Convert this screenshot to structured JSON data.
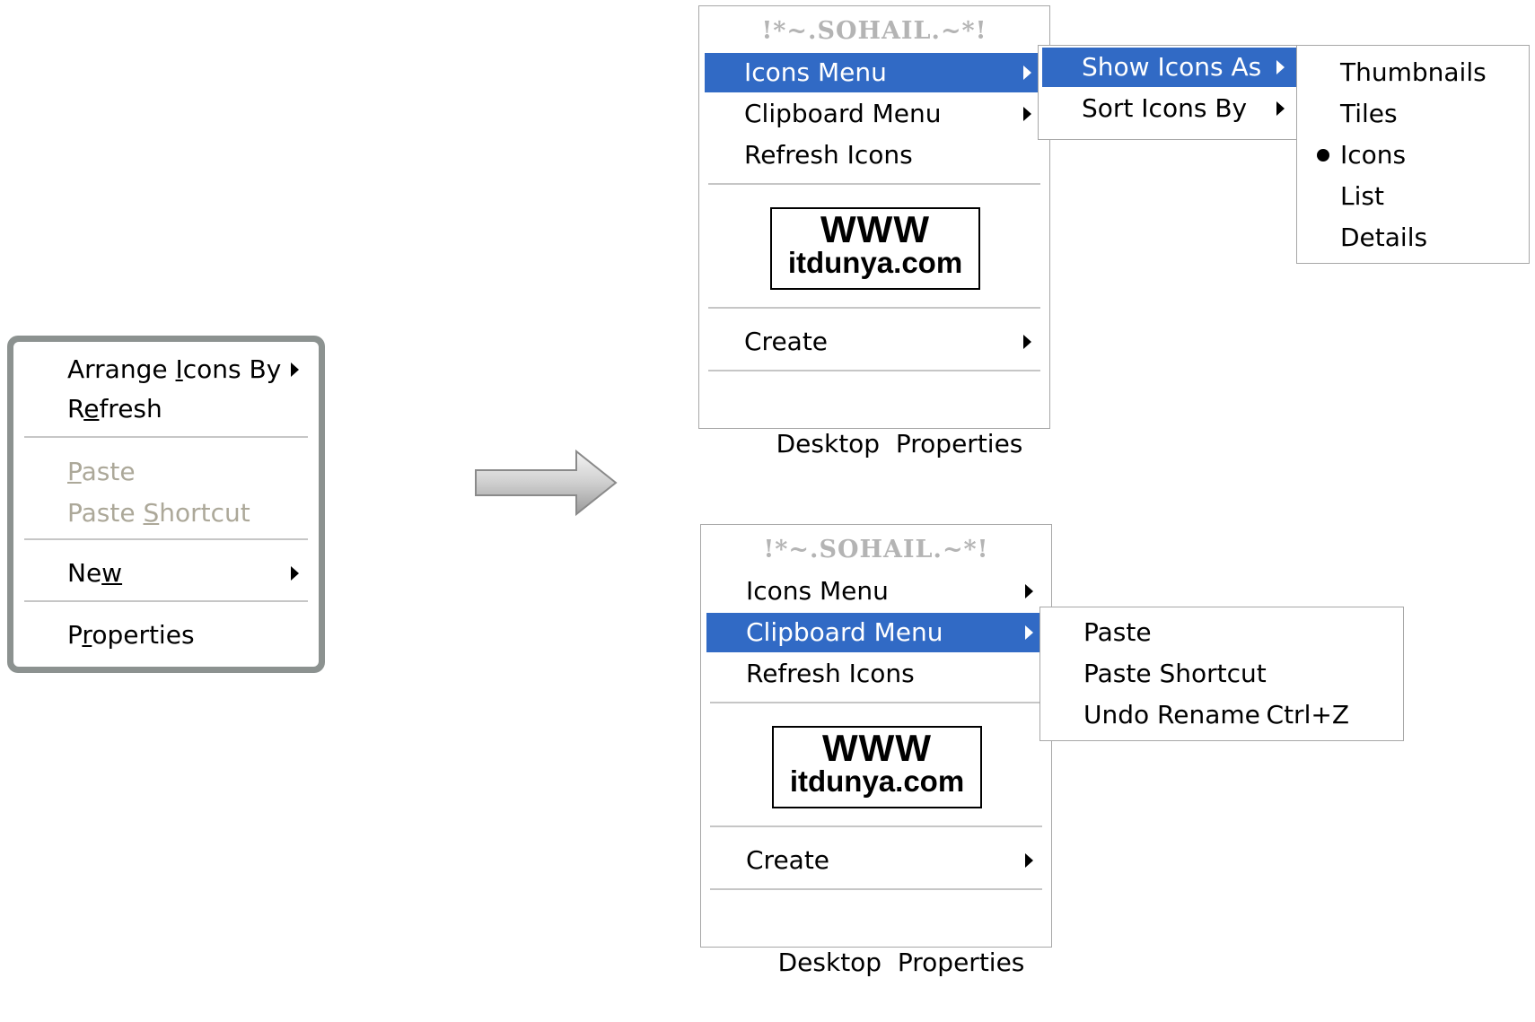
{
  "standard_menu": {
    "items": [
      {
        "label": "Arrange Icons By",
        "underline_index": 9,
        "submenu": true
      },
      {
        "label": "Refresh",
        "underline_index": 2
      },
      {
        "label": "Paste",
        "underline_index": 0,
        "disabled": true
      },
      {
        "label": "Paste Shortcut",
        "underline_index": 6,
        "disabled": true
      },
      {
        "label": "New",
        "underline_index": 2,
        "submenu": true
      },
      {
        "label": "Properties",
        "underline_index": 2
      }
    ]
  },
  "arrow_icon": "right-arrow-icon",
  "custom_menu_top": {
    "title": "!*~.SOHAIL.~*!",
    "items": [
      {
        "label": "Icons Menu",
        "submenu": true,
        "selected": true
      },
      {
        "label": "Clipboard Menu",
        "submenu": true
      },
      {
        "label": "Refresh Icons"
      }
    ],
    "logo": {
      "line1": "WWW",
      "line2": "itdunya.com"
    },
    "create": "Create",
    "properties": "Desktop  Properties"
  },
  "icons_submenu": {
    "items": [
      {
        "label": "Show Icons As",
        "submenu": true,
        "selected": true
      },
      {
        "label": "Sort Icons By",
        "submenu": true
      }
    ]
  },
  "show_icons_as_submenu": {
    "items": [
      {
        "label": "Thumbnails"
      },
      {
        "label": "Tiles"
      },
      {
        "label": "Icons",
        "checked": true
      },
      {
        "label": "List"
      },
      {
        "label": "Details"
      }
    ]
  },
  "custom_menu_bottom": {
    "title": "!*~.SOHAIL.~*!",
    "items": [
      {
        "label": "Icons Menu",
        "submenu": true
      },
      {
        "label": "Clipboard Menu",
        "submenu": true,
        "selected": true
      },
      {
        "label": "Refresh Icons"
      }
    ],
    "logo": {
      "line1": "WWW",
      "line2": "itdunya.com"
    },
    "create": "Create",
    "properties": "Desktop  Properties"
  },
  "clipboard_submenu": {
    "items": [
      {
        "label": "Paste"
      },
      {
        "label": "Paste Shortcut"
      },
      {
        "label": "Undo Rename",
        "shortcut": "Ctrl+Z"
      }
    ]
  },
  "colors": {
    "highlight": "#316ac5",
    "disabled_text": "#aca899",
    "title_text": "#b4b4b4"
  }
}
